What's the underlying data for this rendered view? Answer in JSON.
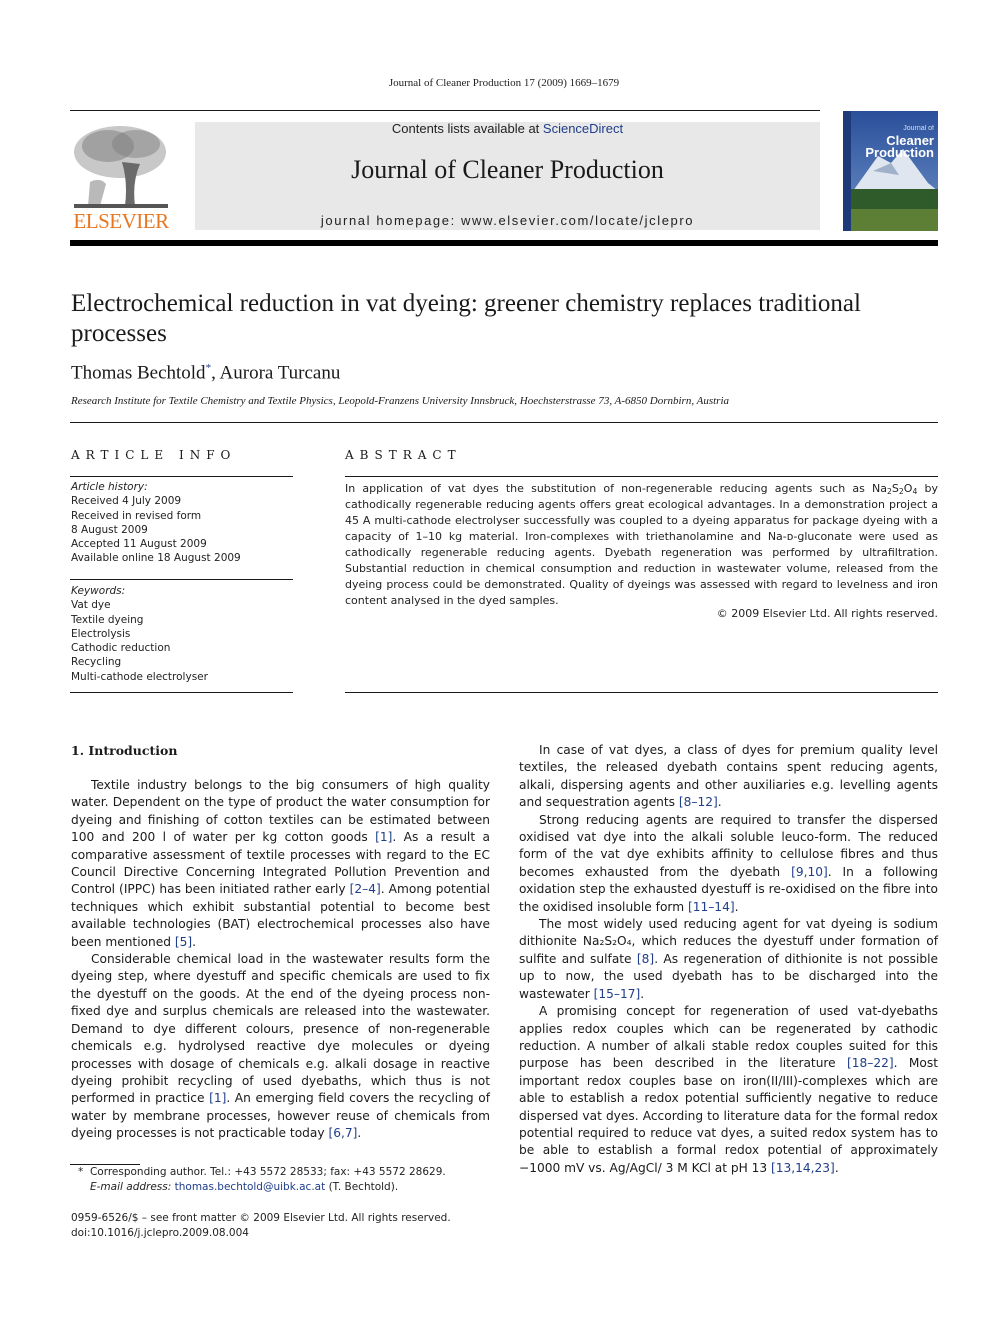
{
  "header": {
    "running_head": "Journal of Cleaner Production 17 (2009) 1669–1679",
    "contents_prefix": "Contents lists available at ",
    "contents_link": "ScienceDirect",
    "journal_title": "Journal of Cleaner Production",
    "homepage": "journal homepage: www.elsevier.com/locate/jclepro",
    "publisher_logo": "ELSEVIER",
    "cover": {
      "line1": "Journal of",
      "line2": "Cleaner",
      "line3": "Production"
    },
    "colors": {
      "elsevier_orange": "#e87722",
      "link_blue": "#1f3d8a",
      "masthead_gray": "#e8e8e8"
    }
  },
  "article": {
    "title": "Electrochemical reduction in vat dyeing: greener chemistry replaces traditional processes",
    "authors": [
      {
        "name": "Thomas Bechtold",
        "mark": "*"
      },
      {
        "name": "Aurora Turcanu",
        "mark": ""
      }
    ],
    "author_separator": ", ",
    "affiliation": "Research Institute for Textile Chemistry and Textile Physics, Leopold-Franzens University Innsbruck, Hoechsterstrasse 73, A-6850 Dornbirn, Austria"
  },
  "article_info": {
    "heading": "ARTICLE INFO",
    "history_label": "Article history:",
    "history": [
      "Received 4 July 2009",
      "Received in revised form",
      "8 August 2009",
      "Accepted 11 August 2009",
      "Available online 18 August 2009"
    ],
    "keywords_label": "Keywords:",
    "keywords": [
      "Vat dye",
      "Textile dyeing",
      "Electrolysis",
      "Cathodic reduction",
      "Recycling",
      "Multi-cathode electrolyser"
    ]
  },
  "abstract": {
    "heading": "ABSTRACT",
    "text_a": "In application of vat dyes the substitution of non-regenerable reducing agents such as Na",
    "sub1": "2",
    "text_b": "S",
    "sub2": "2",
    "text_c": "O",
    "sub3": "4",
    "text_d": " by cathodically regenerable reducing agents offers great ecological advantages. In a demonstration project a 45 A multi-cathode electrolyser successfully was coupled to a dyeing apparatus for package dyeing with a capacity of 1–10 kg material. Iron-complexes with triethanolamine and Na-ᴅ-gluconate were used as cathodically regenerable reducing agents. Dyebath regeneration was performed by ultrafiltration. Substantial reduction in chemical consumption and reduction in wastewater volume, released from the dyeing process could be demonstrated. Quality of dyeings was assessed with regard to levelness and iron content analysed in the dyed samples.",
    "copyright": "© 2009 Elsevier Ltd. All rights reserved."
  },
  "body": {
    "section_heading": "1.  Introduction",
    "left": [
      {
        "parts": [
          {
            "t": "Textile industry belongs to the big consumers of high quality water. Dependent on the type of product the water consumption for dyeing and finishing of cotton textiles can be estimated between 100 and 200 l of water per kg cotton goods "
          },
          {
            "r": "[1]"
          },
          {
            "t": ". As a result a comparative assessment of textile processes with regard to the EC Council Directive Concerning Integrated Pollution Prevention and Control (IPPC) has been initiated rather early "
          },
          {
            "r": "[2–4]"
          },
          {
            "t": ". Among potential techniques which exhibit substantial potential to become best available technologies (BAT) electrochemical processes also have been mentioned "
          },
          {
            "r": "[5]"
          },
          {
            "t": "."
          }
        ]
      },
      {
        "parts": [
          {
            "t": "Considerable chemical load in the wastewater results form the dyeing step, where dyestuff and specific chemicals are used to fix the dyestuff on the goods. At the end of the dyeing process non-fixed dye and surplus chemicals are released into the wastewater. Demand to dye different colours, presence of non-regenerable chemicals e.g. hydrolysed reactive dye molecules or dyeing processes with dosage of chemicals e.g. alkali dosage in reactive dyeing prohibit recycling of used dyebaths, which thus is not performed in practice "
          },
          {
            "r": "[1]"
          },
          {
            "t": ". An emerging field covers the recycling of water by membrane processes, however reuse of chemicals from dyeing processes is not practicable today "
          },
          {
            "r": "[6,7]"
          },
          {
            "t": "."
          }
        ]
      }
    ],
    "right": [
      {
        "parts": [
          {
            "t": "In case of vat dyes, a class of dyes for premium quality level textiles, the released dyebath contains spent reducing agents, alkali, dispersing agents and other auxiliaries e.g. levelling agents and sequestration agents "
          },
          {
            "r": "[8–12]"
          },
          {
            "t": "."
          }
        ]
      },
      {
        "parts": [
          {
            "t": "Strong reducing agents are required to transfer the dispersed oxidised vat dye into the alkali soluble leuco-form. The reduced form of the vat dye exhibits affinity to cellulose fibres and thus becomes exhausted from the dyebath "
          },
          {
            "r": "[9,10]"
          },
          {
            "t": ". In a following oxidation step the exhausted dyestuff is re-oxidised on the fibre into the oxidised insoluble form "
          },
          {
            "r": "[11–14]"
          },
          {
            "t": "."
          }
        ]
      },
      {
        "parts": [
          {
            "t": "The most widely used reducing agent for vat dyeing is sodium dithionite Na₂S₂O₄, which reduces the dyestuff under formation of sulfite and sulfate "
          },
          {
            "r": "[8]"
          },
          {
            "t": ". As regeneration of dithionite is not possible up to now, the used dyebath has to be discharged into the wastewater "
          },
          {
            "r": "[15–17]"
          },
          {
            "t": "."
          }
        ]
      },
      {
        "parts": [
          {
            "t": "A promising concept for regeneration of used vat-dyebaths applies redox couples which can be regenerated by cathodic reduction. A number of alkali stable redox couples suited for this purpose has been described in the literature "
          },
          {
            "r": "[18–22]"
          },
          {
            "t": ". Most important redox couples base on iron(II/III)-complexes which are able to establish a redox potential sufficiently negative to reduce dispersed vat dyes. According to literature data for the formal redox potential required to reduce vat dyes, a suited redox system has to be able to establish a formal redox potential of approximately −1000 mV vs. Ag/AgCl/ 3 M KCl at pH 13 "
          },
          {
            "r": "[13,14,23]"
          },
          {
            "t": "."
          }
        ]
      }
    ]
  },
  "footnotes": {
    "corresponding": "Corresponding author. Tel.: +43 5572 28533; fax: +43 5572 28629.",
    "corresponding_mark": "*",
    "email_label": "E-mail address: ",
    "email": "thomas.bechtold@uibk.ac.at",
    "email_suffix": " (T. Bechtold).",
    "issn_line": "0959-6526/$ – see front matter © 2009 Elsevier Ltd. All rights reserved.",
    "doi": "doi:10.1016/j.jclepro.2009.08.004"
  }
}
